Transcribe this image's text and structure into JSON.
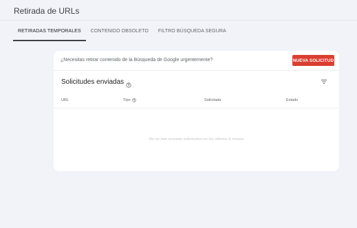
{
  "header": {
    "title": "Retirada de URLs"
  },
  "tabs": [
    {
      "label": "RETIRADAS TEMPORALES",
      "active": true
    },
    {
      "label": "CONTENIDO OBSOLETO",
      "active": false
    },
    {
      "label": "FILTRO BÚSQUEDA SEGURA",
      "active": false
    }
  ],
  "banner": {
    "text": "¿Necesitas retirar contenido de la Búsqueda de Google urgentemente?",
    "button_label": "NUEVA SOLICITUD"
  },
  "section": {
    "title": "Solicitudes enviadas",
    "icons": {
      "help": "help-circle-icon",
      "filter": "filter-icon"
    }
  },
  "table": {
    "columns": [
      "URL",
      "Tipo",
      "Solicitada",
      "Estado"
    ],
    "rows": [],
    "empty_message": "No se han enviado solicitudes en los últimos 6 meses"
  },
  "colors": {
    "accent": "#d93f2f",
    "background": "#f1f3f9",
    "card": "#ffffff"
  }
}
